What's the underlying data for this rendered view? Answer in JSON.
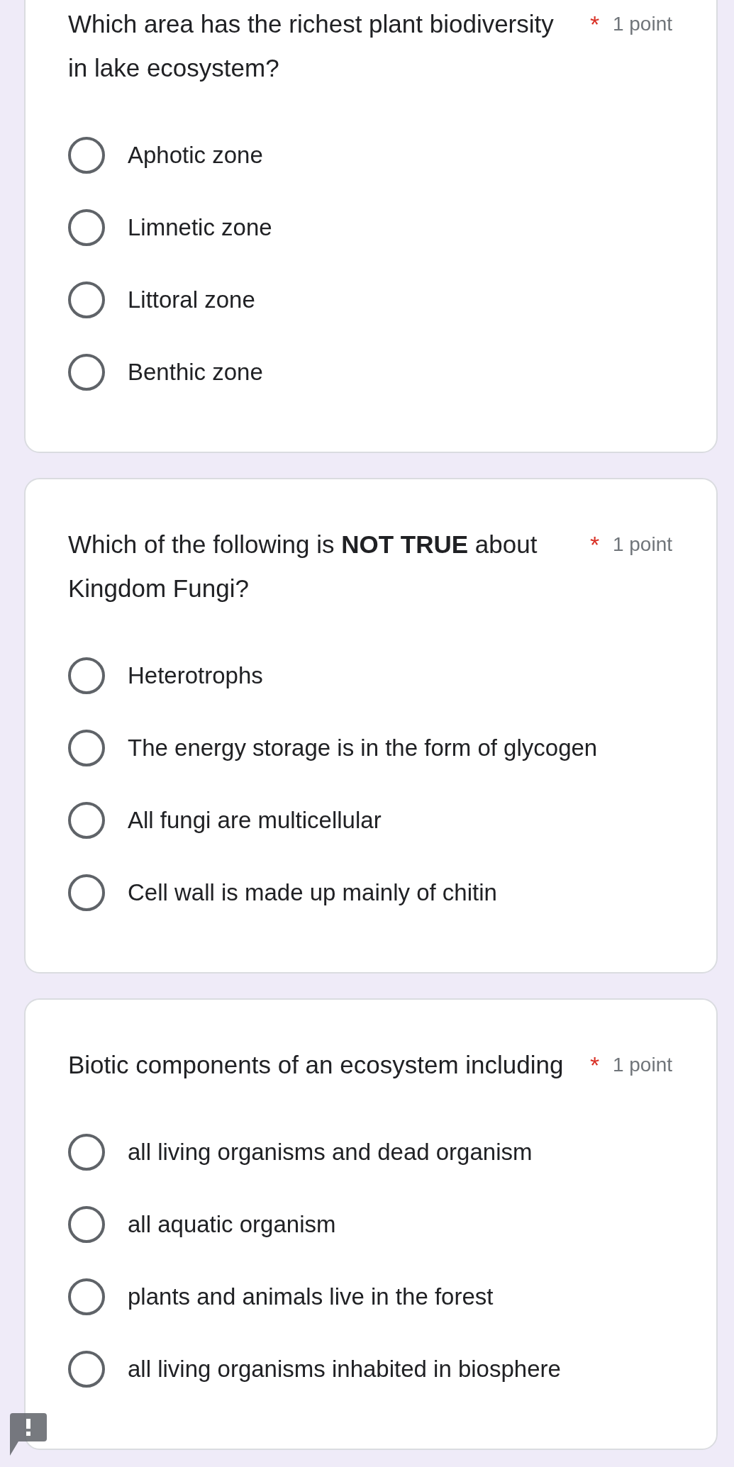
{
  "questions": [
    {
      "text": "Which area has the richest plant biodiversity in lake ecosystem?",
      "required_mark": "*",
      "points": "1 point",
      "options": [
        {
          "label": "Aphotic zone",
          "selected": false
        },
        {
          "label": "Limnetic zone",
          "selected": false
        },
        {
          "label": "Littoral zone",
          "selected": false
        },
        {
          "label": "Benthic zone",
          "selected": false
        }
      ]
    },
    {
      "text": "Which of the following is **NOT TRUE** about Kingdom Fungi?",
      "required_mark": "*",
      "points": "1 point",
      "options": [
        {
          "label": "Heterotrophs",
          "selected": false
        },
        {
          "label": "The energy storage is in the form of glycogen",
          "selected": false
        },
        {
          "label": "All fungi are multicellular",
          "selected": false
        },
        {
          "label": "Cell wall is made up mainly of chitin",
          "selected": false
        }
      ]
    },
    {
      "text": "Biotic components of an ecosystem including",
      "required_mark": "*",
      "points": "1 point",
      "options": [
        {
          "label": "all living organisms and dead organism",
          "selected": false
        },
        {
          "label": "all aquatic organism",
          "selected": false
        },
        {
          "label": "plants and animals live in the forest",
          "selected": false
        },
        {
          "label": "all living organisms inhabited in biosphere",
          "selected": false
        }
      ]
    }
  ]
}
